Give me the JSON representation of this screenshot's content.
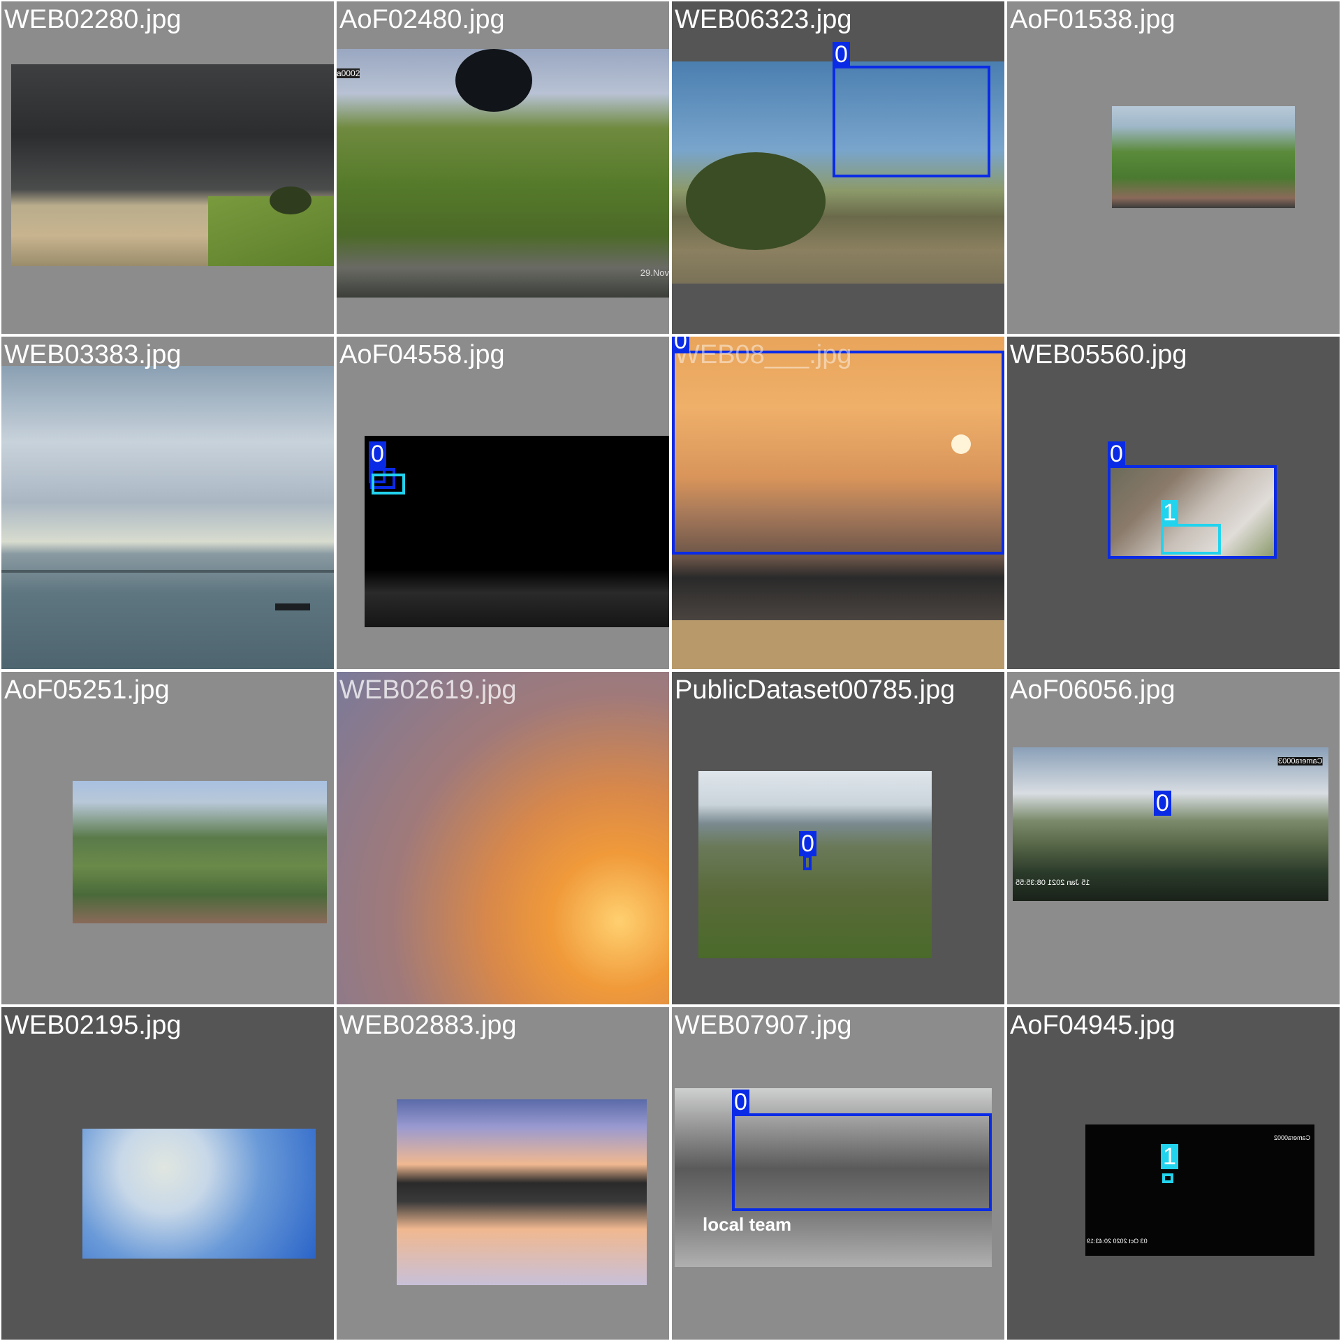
{
  "colors": {
    "class0": "#0a2be6",
    "class1": "#22d3ee",
    "title_text": "#ffffff"
  },
  "tiles": [
    {
      "filename": "WEB02280.jpg"
    },
    {
      "filename": "AoF02480.jpg",
      "overlay_texts": [
        "a0002",
        "29.Nov"
      ]
    },
    {
      "filename": "WEB06323.jpg",
      "labels": [
        "0"
      ]
    },
    {
      "filename": "AoF01538.jpg"
    },
    {
      "filename": "WEB03383.jpg"
    },
    {
      "filename": "AoF04558.jpg",
      "labels": [
        "0"
      ]
    },
    {
      "filename": "WEB08___.jpg",
      "labels": [
        "0"
      ]
    },
    {
      "filename": "WEB05560.jpg",
      "labels": [
        "0",
        "1"
      ]
    },
    {
      "filename": "AoF05251.jpg"
    },
    {
      "filename": "WEB02619.jpg"
    },
    {
      "filename": "PublicDataset00785.jpg",
      "labels": [
        "0"
      ]
    },
    {
      "filename": "AoF06056.jpg",
      "labels": [
        "0"
      ],
      "overlay_texts": [
        "Camera0003",
        "15 Jan 2021 08:35:55"
      ]
    },
    {
      "filename": "WEB02195.jpg"
    },
    {
      "filename": "WEB02883.jpg"
    },
    {
      "filename": "WEB07907.jpg",
      "labels": [
        "0"
      ],
      "overlay_texts": [
        "local team"
      ]
    },
    {
      "filename": "AoF04945.jpg",
      "labels": [
        "1"
      ],
      "overlay_texts": [
        "Camera0002",
        "03 Oct 2020 20:43:19"
      ]
    }
  ]
}
